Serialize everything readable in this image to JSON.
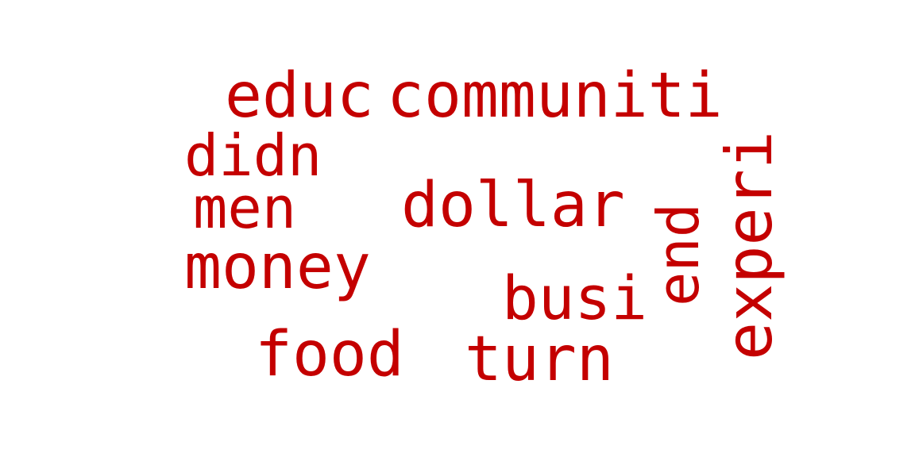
{
  "cloud": {
    "color": "#c40000",
    "words": [
      {
        "text": "educ"
      },
      {
        "text": "communiti"
      },
      {
        "text": "didn"
      },
      {
        "text": "men"
      },
      {
        "text": "dollar"
      },
      {
        "text": "money"
      },
      {
        "text": "busi"
      },
      {
        "text": "food"
      },
      {
        "text": "turn"
      },
      {
        "text": "end"
      },
      {
        "text": "experi"
      }
    ]
  }
}
